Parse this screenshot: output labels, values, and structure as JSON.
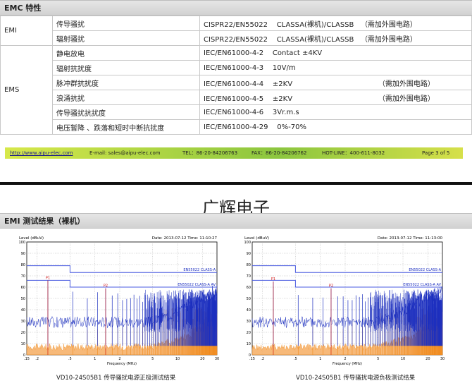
{
  "emc_section": {
    "title": "EMC 特性",
    "rows": [
      {
        "category": "EMI",
        "items": [
          {
            "item": "传导骚扰",
            "standard": "CISPR22/EN55022",
            "value": "CLASSA(裸机)/CLASSB",
            "note": "（需加外围电路）"
          },
          {
            "item": "辐射骚扰",
            "standard": "CISPR22/EN55022",
            "value": "CLASSA(裸机)/CLASSB",
            "note": "（需加外围电路）"
          }
        ]
      },
      {
        "category": "EMS",
        "items": [
          {
            "item": "静电放电",
            "standard": "IEC/EN61000-4-2",
            "value": "Contact ±4KV",
            "note": ""
          },
          {
            "item": "辐射抗扰度",
            "standard": "IEC/EN61000-4-3",
            "value": "10V/m",
            "note": ""
          },
          {
            "item": "脉冲群抗扰度",
            "standard": "IEC/EN61000-4-4",
            "value": "±2KV",
            "note": "（需加外围电路）"
          },
          {
            "item": "浪涌抗扰",
            "standard": "IEC/EN61000-4-5",
            "value": "±2KV",
            "note": "（需加外围电路）"
          },
          {
            "item": "传导骚扰抗扰度",
            "standard": "IEC/EN61000-4-6",
            "value": "3Vr.m.s",
            "note": ""
          },
          {
            "item": "电压暂降 、跌落和短时中断抗扰度",
            "standard": "IEC/EN61000-4-29",
            "value": "0%-70%",
            "note": ""
          }
        ]
      }
    ]
  },
  "footer": {
    "url": "http://www.aipu-elec.com",
    "email": "E-mail: sales@aipu-elec.com",
    "tel": "TEL：86-20-84206763",
    "fax": "FAX：86-20-84206762",
    "hotline": "HOT-LINE：400-611-8032",
    "page": "Page 3 of 5"
  },
  "brand": "广辉电子",
  "emi_section": {
    "title": "EMI 测试结果（裸机）"
  },
  "charts": [
    {
      "caption": "VD10-24S05B1 传导骚扰电源正极测试结果",
      "header_left": "Level (dBuV)",
      "header_right": "Date: 2013-07-12  Time: 11:10:27",
      "xlabel": "Frequency (MHz)",
      "limit_a_label": "EN55022 CLASS-A",
      "limit_av_label": "EN55022 CLASS-A AV",
      "marker_labels": [
        "P1",
        "P2"
      ]
    },
    {
      "caption": "VD10-24S05B1 传导骚扰电源负极测试结果",
      "header_left": "Level (dBuV)",
      "header_right": "Date: 2013-07-12  Time: 11:13:00",
      "xlabel": "Frequency (MHz)",
      "limit_a_label": "EN55022 CLASS-A",
      "limit_av_label": "EN55022 CLASS-A AV",
      "marker_labels": [
        "P1",
        "P2"
      ]
    }
  ],
  "chart_data": [
    {
      "type": "line",
      "x_scale": "log",
      "xlim": [
        0.15,
        30
      ],
      "ylim": [
        0,
        100
      ],
      "x_ticks": [
        ".15",
        ".2",
        ".5",
        "1",
        "2",
        "5",
        "10",
        "20",
        "30"
      ],
      "y_ticks": [
        "0",
        "10",
        "20",
        "30",
        "40",
        "50",
        "60",
        "70",
        "80",
        "90",
        "100"
      ],
      "limits": [
        {
          "name": "EN55022 CLASS-A",
          "x": [
            0.15,
            0.5,
            0.5,
            30
          ],
          "y": [
            79,
            79,
            73,
            73
          ]
        },
        {
          "name": "EN55022 CLASS-A AV",
          "x": [
            0.15,
            0.5,
            0.5,
            30
          ],
          "y": [
            66,
            66,
            60,
            60
          ]
        }
      ],
      "peaks": [
        {
          "label": "P1",
          "x": 0.27,
          "y": 66
        },
        {
          "label": "P2",
          "x": 1.35,
          "y": 59
        }
      ]
    },
    {
      "type": "line",
      "x_scale": "log",
      "xlim": [
        0.15,
        30
      ],
      "ylim": [
        0,
        100
      ],
      "x_ticks": [
        ".15",
        ".2",
        ".5",
        "1",
        "2",
        "5",
        "10",
        "20",
        "30"
      ],
      "y_ticks": [
        "0",
        "10",
        "20",
        "30",
        "40",
        "50",
        "60",
        "70",
        "80",
        "90",
        "100"
      ],
      "limits": [
        {
          "name": "EN55022 CLASS-A",
          "x": [
            0.15,
            0.5,
            0.5,
            30
          ],
          "y": [
            79,
            79,
            73,
            73
          ]
        },
        {
          "name": "EN55022 CLASS-A AV",
          "x": [
            0.15,
            0.5,
            0.5,
            30
          ],
          "y": [
            66,
            66,
            60,
            60
          ]
        }
      ],
      "peaks": [
        {
          "label": "P1",
          "x": 0.27,
          "y": 65
        },
        {
          "label": "P2",
          "x": 1.35,
          "y": 59
        }
      ]
    }
  ]
}
